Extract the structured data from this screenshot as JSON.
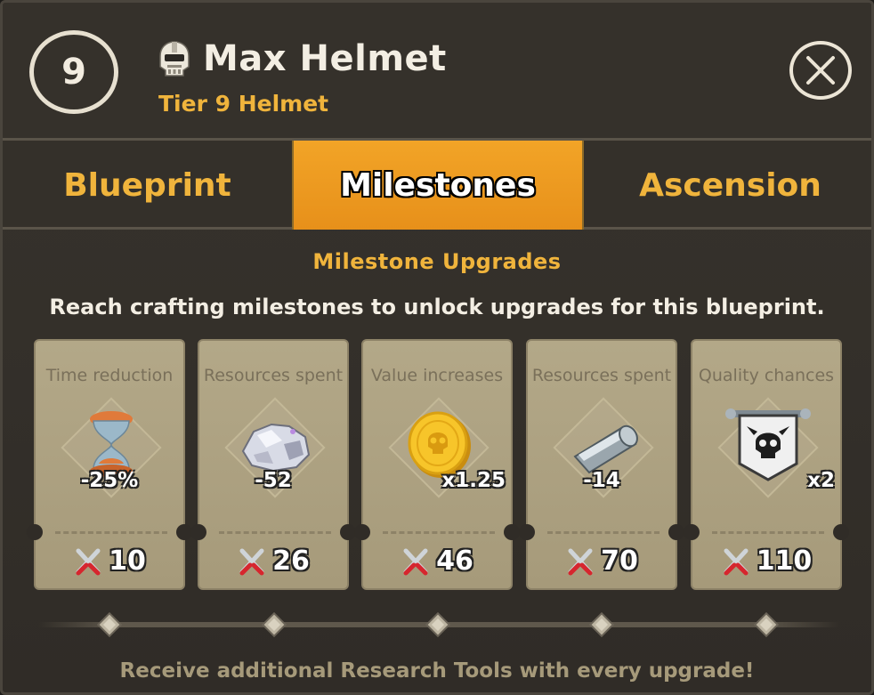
{
  "header": {
    "tier_number": "9",
    "title": "Max Helmet",
    "subtitle": "Tier 9 Helmet",
    "icon": "helmet-icon",
    "close_icon": "close-icon"
  },
  "tabs": [
    {
      "label": "Blueprint",
      "active": false
    },
    {
      "label": "Milestones",
      "active": true
    },
    {
      "label": "Ascension",
      "active": false
    }
  ],
  "section": {
    "title": "Milestone Upgrades",
    "description": "Reach crafting milestones to unlock upgrades for this blueprint."
  },
  "milestones": [
    {
      "label": "Time reduction",
      "icon": "hourglass-icon",
      "value": "-25%",
      "cost": "10",
      "cost_icon": "research-tools-icon"
    },
    {
      "label": "Resources spent",
      "icon": "ore-icon",
      "value": "-52",
      "cost": "26",
      "cost_icon": "research-tools-icon"
    },
    {
      "label": "Value increases",
      "icon": "gold-coin-icon",
      "value": "x1.25",
      "cost": "46",
      "cost_icon": "research-tools-icon"
    },
    {
      "label": "Resources spent",
      "icon": "metal-bar-icon",
      "value": "-14",
      "cost": "70",
      "cost_icon": "research-tools-icon"
    },
    {
      "label": "Quality chances",
      "icon": "skull-banner-icon",
      "value": "x2",
      "cost": "110",
      "cost_icon": "research-tools-icon"
    }
  ],
  "footer": {
    "note": "Receive additional Research Tools with every upgrade!"
  },
  "colors": {
    "accent_gold": "#f0b43c",
    "active_tab": "#f2a427",
    "card_bg": "#b3a888",
    "panel_bg": "#34302a"
  }
}
